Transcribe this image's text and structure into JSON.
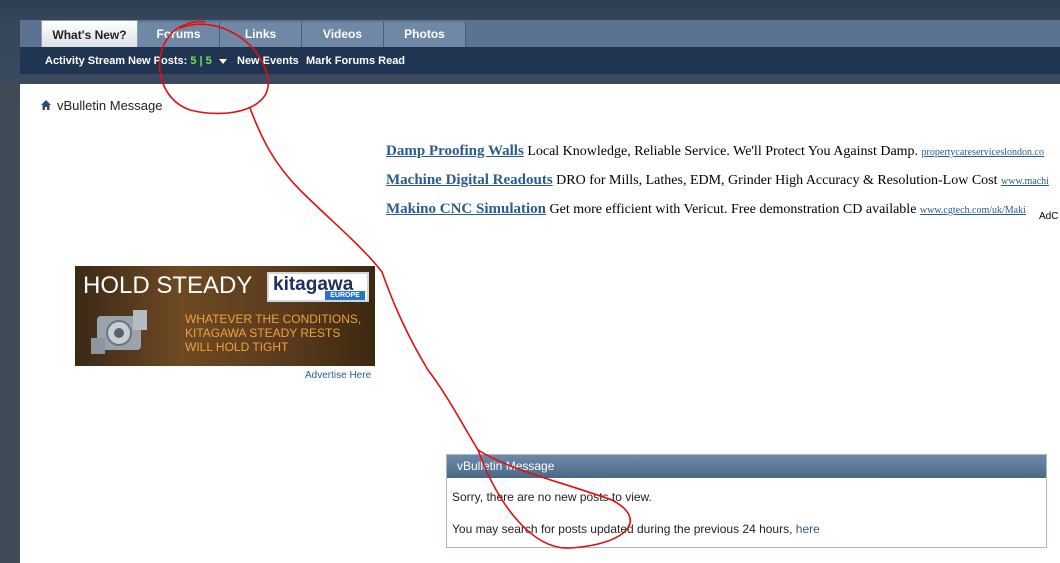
{
  "nav": {
    "tabs": [
      {
        "label": "What's New?"
      },
      {
        "label": "Forums"
      },
      {
        "label": "Links"
      },
      {
        "label": "Videos"
      },
      {
        "label": "Photos"
      }
    ],
    "subnav": {
      "activity_stream": "Activity Stream",
      "new_posts": "New Posts:",
      "new_posts_count": "5 | 5",
      "new_events": "New Events",
      "mark_read": "Mark Forums Read"
    }
  },
  "breadcrumb": {
    "title": "vBulletin Message"
  },
  "ads": [
    {
      "title": "Damp Proofing Walls",
      "text": "Local Knowledge, Reliable Service. We'll Protect You Against Damp.",
      "url": "propertycareserviceslondon.co"
    },
    {
      "title": "Machine Digital Readouts",
      "text": "DRO for Mills, Lathes, EDM, Grinder High Accuracy & Resolution-Low Cost",
      "url": "www.machi"
    },
    {
      "title": "Makino CNC Simulation",
      "text": "Get more efficient with Vericut. Free demonstration CD available",
      "url": "www.cgtech.com/uk/Maki"
    }
  ],
  "adchoices": "AdC",
  "banner": {
    "headline": "HOLD STEADY",
    "logo": "kitagawa",
    "logo_sub": "EUROPE",
    "copy": "WHATEVER THE CONDITIONS, KITAGAWA STEADY RESTS WILL HOLD TIGHT",
    "advertise": "Advertise Here"
  },
  "message": {
    "header": "vBulletin Message",
    "line1": "Sorry, there are no new posts to view.",
    "line2": "You may search for posts updated during the previous 24 hours,",
    "link": "here"
  },
  "colors": {
    "accent": "#2a5d8f",
    "annotation": "#e01010",
    "new_count": "#6ee84a"
  }
}
